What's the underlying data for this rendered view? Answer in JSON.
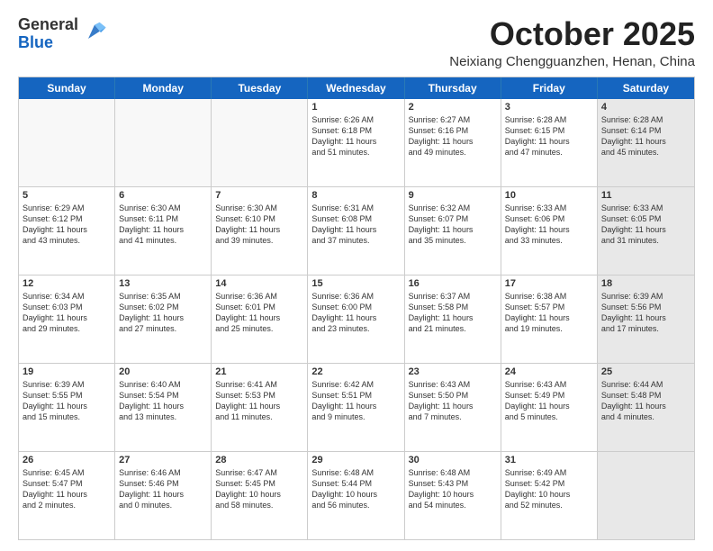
{
  "header": {
    "logo": {
      "general": "General",
      "blue": "Blue"
    },
    "title": "October 2025",
    "location": "Neixiang Chengguanzhen, Henan, China"
  },
  "days_of_week": [
    "Sunday",
    "Monday",
    "Tuesday",
    "Wednesday",
    "Thursday",
    "Friday",
    "Saturday"
  ],
  "rows": [
    [
      {
        "day": "",
        "info": "",
        "empty": true
      },
      {
        "day": "",
        "info": "",
        "empty": true
      },
      {
        "day": "",
        "info": "",
        "empty": true
      },
      {
        "day": "1",
        "info": "Sunrise: 6:26 AM\nSunset: 6:18 PM\nDaylight: 11 hours\nand 51 minutes.",
        "empty": false
      },
      {
        "day": "2",
        "info": "Sunrise: 6:27 AM\nSunset: 6:16 PM\nDaylight: 11 hours\nand 49 minutes.",
        "empty": false
      },
      {
        "day": "3",
        "info": "Sunrise: 6:28 AM\nSunset: 6:15 PM\nDaylight: 11 hours\nand 47 minutes.",
        "empty": false
      },
      {
        "day": "4",
        "info": "Sunrise: 6:28 AM\nSunset: 6:14 PM\nDaylight: 11 hours\nand 45 minutes.",
        "empty": false,
        "gray": true
      }
    ],
    [
      {
        "day": "5",
        "info": "Sunrise: 6:29 AM\nSunset: 6:12 PM\nDaylight: 11 hours\nand 43 minutes.",
        "empty": false
      },
      {
        "day": "6",
        "info": "Sunrise: 6:30 AM\nSunset: 6:11 PM\nDaylight: 11 hours\nand 41 minutes.",
        "empty": false
      },
      {
        "day": "7",
        "info": "Sunrise: 6:30 AM\nSunset: 6:10 PM\nDaylight: 11 hours\nand 39 minutes.",
        "empty": false
      },
      {
        "day": "8",
        "info": "Sunrise: 6:31 AM\nSunset: 6:08 PM\nDaylight: 11 hours\nand 37 minutes.",
        "empty": false
      },
      {
        "day": "9",
        "info": "Sunrise: 6:32 AM\nSunset: 6:07 PM\nDaylight: 11 hours\nand 35 minutes.",
        "empty": false
      },
      {
        "day": "10",
        "info": "Sunrise: 6:33 AM\nSunset: 6:06 PM\nDaylight: 11 hours\nand 33 minutes.",
        "empty": false
      },
      {
        "day": "11",
        "info": "Sunrise: 6:33 AM\nSunset: 6:05 PM\nDaylight: 11 hours\nand 31 minutes.",
        "empty": false,
        "gray": true
      }
    ],
    [
      {
        "day": "12",
        "info": "Sunrise: 6:34 AM\nSunset: 6:03 PM\nDaylight: 11 hours\nand 29 minutes.",
        "empty": false
      },
      {
        "day": "13",
        "info": "Sunrise: 6:35 AM\nSunset: 6:02 PM\nDaylight: 11 hours\nand 27 minutes.",
        "empty": false
      },
      {
        "day": "14",
        "info": "Sunrise: 6:36 AM\nSunset: 6:01 PM\nDaylight: 11 hours\nand 25 minutes.",
        "empty": false
      },
      {
        "day": "15",
        "info": "Sunrise: 6:36 AM\nSunset: 6:00 PM\nDaylight: 11 hours\nand 23 minutes.",
        "empty": false
      },
      {
        "day": "16",
        "info": "Sunrise: 6:37 AM\nSunset: 5:58 PM\nDaylight: 11 hours\nand 21 minutes.",
        "empty": false
      },
      {
        "day": "17",
        "info": "Sunrise: 6:38 AM\nSunset: 5:57 PM\nDaylight: 11 hours\nand 19 minutes.",
        "empty": false
      },
      {
        "day": "18",
        "info": "Sunrise: 6:39 AM\nSunset: 5:56 PM\nDaylight: 11 hours\nand 17 minutes.",
        "empty": false,
        "gray": true
      }
    ],
    [
      {
        "day": "19",
        "info": "Sunrise: 6:39 AM\nSunset: 5:55 PM\nDaylight: 11 hours\nand 15 minutes.",
        "empty": false
      },
      {
        "day": "20",
        "info": "Sunrise: 6:40 AM\nSunset: 5:54 PM\nDaylight: 11 hours\nand 13 minutes.",
        "empty": false
      },
      {
        "day": "21",
        "info": "Sunrise: 6:41 AM\nSunset: 5:53 PM\nDaylight: 11 hours\nand 11 minutes.",
        "empty": false
      },
      {
        "day": "22",
        "info": "Sunrise: 6:42 AM\nSunset: 5:51 PM\nDaylight: 11 hours\nand 9 minutes.",
        "empty": false
      },
      {
        "day": "23",
        "info": "Sunrise: 6:43 AM\nSunset: 5:50 PM\nDaylight: 11 hours\nand 7 minutes.",
        "empty": false
      },
      {
        "day": "24",
        "info": "Sunrise: 6:43 AM\nSunset: 5:49 PM\nDaylight: 11 hours\nand 5 minutes.",
        "empty": false
      },
      {
        "day": "25",
        "info": "Sunrise: 6:44 AM\nSunset: 5:48 PM\nDaylight: 11 hours\nand 4 minutes.",
        "empty": false,
        "gray": true
      }
    ],
    [
      {
        "day": "26",
        "info": "Sunrise: 6:45 AM\nSunset: 5:47 PM\nDaylight: 11 hours\nand 2 minutes.",
        "empty": false
      },
      {
        "day": "27",
        "info": "Sunrise: 6:46 AM\nSunset: 5:46 PM\nDaylight: 11 hours\nand 0 minutes.",
        "empty": false
      },
      {
        "day": "28",
        "info": "Sunrise: 6:47 AM\nSunset: 5:45 PM\nDaylight: 10 hours\nand 58 minutes.",
        "empty": false
      },
      {
        "day": "29",
        "info": "Sunrise: 6:48 AM\nSunset: 5:44 PM\nDaylight: 10 hours\nand 56 minutes.",
        "empty": false
      },
      {
        "day": "30",
        "info": "Sunrise: 6:48 AM\nSunset: 5:43 PM\nDaylight: 10 hours\nand 54 minutes.",
        "empty": false
      },
      {
        "day": "31",
        "info": "Sunrise: 6:49 AM\nSunset: 5:42 PM\nDaylight: 10 hours\nand 52 minutes.",
        "empty": false
      },
      {
        "day": "",
        "info": "",
        "empty": true,
        "gray": true
      }
    ]
  ]
}
